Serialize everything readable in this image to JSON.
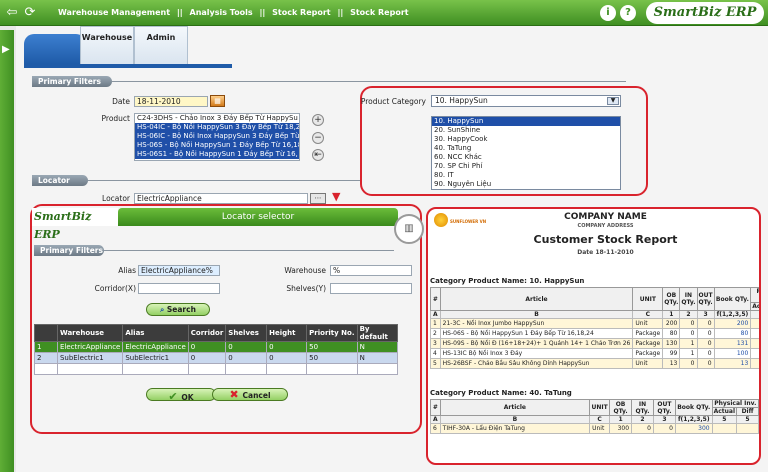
{
  "app": {
    "menu": [
      "Warehouse Management",
      "||",
      "Analysis Tools",
      "||",
      "Stock Report",
      "||",
      "Stock Report"
    ],
    "logo": "SmartBiz ERP",
    "info_icon": "i",
    "help_icon": "?"
  },
  "tabs": [
    {
      "label": "Warehouse"
    },
    {
      "label": "Admin"
    }
  ],
  "primary_filters": {
    "title": "Primary Filters",
    "date_label": "Date",
    "date_value": "18-11-2010",
    "product_label": "Product",
    "product_list": [
      "C24-3DHS - Chảo Inox 3 Đáy Bếp Từ HappySu",
      "HS-04IC - Bộ Nồi HappySun 3 Đáy Bếp Từ 18,2",
      "HS-06IC - Bộ Nồi Inox HappySun 3 Đáy Bếp Từ",
      "HS-06S - Bộ Nồi HappySun 1 Đáy Bếp Từ 16,18",
      "HS-06S1 - Bộ Nồi HappySun 1 Đáy Bếp Từ 16,"
    ],
    "product_category_label": "Product Category",
    "product_category_value": "10. HappySun",
    "category_list": [
      "10. HappySun",
      "20. SunShine",
      "30. HappyCook",
      "40. TaTung",
      "60. NCC Khác",
      "70. SP Chi Phí",
      "80. IT",
      "90. Nguyên Liệu"
    ]
  },
  "locator": {
    "title": "Locator",
    "label": "Locator",
    "value": "ElectricAppliance"
  },
  "locator_selector": {
    "logo": "SmartBiz ERP",
    "title": "Locator selector",
    "filters_title": "Primary Filters",
    "alias_label": "Alias",
    "alias_value": "ElectricAppliance%",
    "warehouse_label": "Warehouse",
    "warehouse_value": "%",
    "corridor_label": "Corridor(X)",
    "corridor_value": "",
    "shelves_label": "Shelves(Y)",
    "shelves_value": "",
    "search_label": "Search",
    "columns": [
      "",
      "Warehouse",
      "Alias",
      "Corridor",
      "Shelves",
      "Height",
      "Priority No.",
      "By default"
    ],
    "rows": [
      [
        "1",
        "ElectricAppliance",
        "ElectricAppliance",
        "0",
        "0",
        "0",
        "50",
        "N"
      ],
      [
        "2",
        "SubElectric1",
        "SubElectric1",
        "0",
        "0",
        "0",
        "50",
        "N"
      ]
    ],
    "ok_label": "OK",
    "cancel_label": "Cancel"
  },
  "report": {
    "company_name": "COMPANY NAME",
    "company_address": "COMPANY ADDRESS",
    "brand_text": "SUNFLOWER VN",
    "title": "Customer Stock Report",
    "date_line": "Date 18-11-2010",
    "headers": [
      "#",
      "Article",
      "UNIT",
      "OB QTy.",
      "IN QTy.",
      "OUT QTy.",
      "Book QTy.",
      "Physical Inv."
    ],
    "subheaders": [
      "Actual",
      "Diff"
    ],
    "index_row": [
      "A",
      "B",
      "C",
      "1",
      "2",
      "3",
      "f(1,2,3,5)",
      "5",
      "5"
    ],
    "sections": [
      {
        "name": "Category Product Name: 10. HappySun",
        "rows": [
          [
            "1",
            "21-3C - Nồi Inox Jumbo HappySun",
            "Unit",
            "200",
            "0",
            "0",
            "200"
          ],
          [
            "2",
            "HS-06S - Bộ Nồi HappySun 1 Đáy Bếp Từ 16,18,24",
            "Package",
            "80",
            "0",
            "0",
            "80"
          ],
          [
            "3",
            "HS-09S - Bộ Nồi Đ (16+18+24)+ 1 Quánh 14+ 1 Chảo Trơn 26",
            "Package",
            "130",
            "1",
            "0",
            "131"
          ],
          [
            "4",
            "HS-13IC Bộ Nồi Inox 3 Đáy",
            "Package",
            "99",
            "1",
            "0",
            "100"
          ],
          [
            "5",
            "HS-26BSF - Chảo Bầu Sâu Không Dính HappySun",
            "Unit",
            "13",
            "0",
            "0",
            "13"
          ]
        ]
      },
      {
        "name": "Category Product Name: 40. TaTung",
        "rows": [
          [
            "6",
            "TIHF-30A - Lẩu Điện TaTung",
            "Unit",
            "300",
            "0",
            "0",
            "300"
          ]
        ]
      }
    ]
  }
}
